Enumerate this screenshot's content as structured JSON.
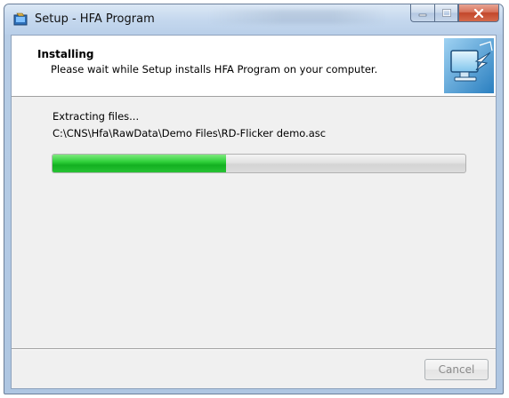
{
  "window": {
    "title": "Setup - HFA Program",
    "icons": {
      "app": "installer-icon",
      "minimize": "minimize-icon",
      "maximize": "maximize-icon",
      "close": "close-icon",
      "header": "setup-computer-icon"
    }
  },
  "header": {
    "title": "Installing",
    "subtitle": "Please wait while Setup installs HFA Program on your computer."
  },
  "main": {
    "status": "Extracting files...",
    "current_file": "C:\\CNS\\Hfa\\RawData\\Demo Files\\RD-Flicker demo.asc",
    "progress_fraction": 0.42
  },
  "footer": {
    "cancel_label": "Cancel",
    "cancel_enabled": false
  },
  "colors": {
    "progress_fill": "#22c42e",
    "title_bar": "#c5d8ee",
    "close_button": "#c2472b",
    "client_bg": "#f0f0f0"
  }
}
